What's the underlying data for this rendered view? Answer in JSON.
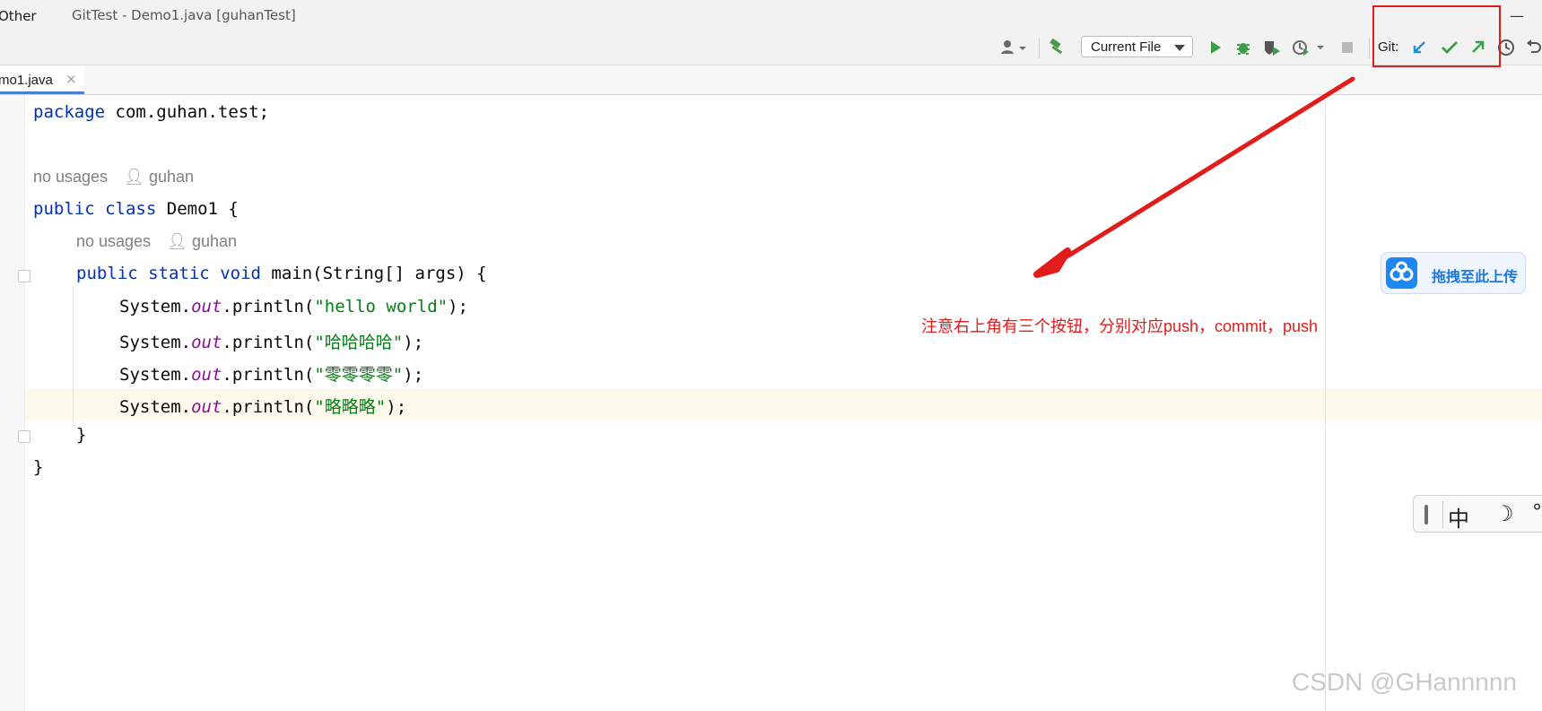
{
  "window": {
    "menu_other": "Other",
    "title": "GitTest - Demo1.java [guhanTest]",
    "minimize_glyph": "—"
  },
  "toolbar": {
    "run_config": "Current File",
    "git_label": "Git:"
  },
  "tab": {
    "label": "mo1.java",
    "close_glyph": "×"
  },
  "editor": {
    "package_kw": "package",
    "package_name": " com.guhan.test;",
    "usage_hint_1": "no usages",
    "author_1": "guhan",
    "class_kw_public": "public",
    "class_kw_class": "class",
    "class_name": "Demo1",
    "class_brace": " {",
    "usage_hint_2": "no usages",
    "author_2": "guhan",
    "method_kw_public": "public",
    "method_kw_static": "static",
    "method_kw_void": "void",
    "method_sig": " main(String[] args) {",
    "println_lines": [
      {
        "pre": "System.",
        "out": "out",
        "mid": ".println(",
        "str": "\"hello world\"",
        "end": ");"
      },
      {
        "pre": "System.",
        "out": "out",
        "mid": ".println(",
        "str": "\"哈哈哈哈\"",
        "end": ");"
      },
      {
        "pre": "System.",
        "out": "out",
        "mid": ".println(",
        "str": "\"零零零零\"",
        "end": ");"
      },
      {
        "pre": "System.",
        "out": "out",
        "mid": ".println(",
        "str": "\"略略略\"",
        "end": ");"
      }
    ],
    "method_close": "}",
    "class_close": "}"
  },
  "annotation": {
    "text": "注意右上角有三个按钮，分别对应push，commit，push",
    "color": "#e21b1b"
  },
  "overlay_upload": {
    "label": "拖拽至此上传"
  },
  "ime": {
    "chinese": "中",
    "moon": "☽",
    "degree": "°"
  },
  "watermark": "CSDN @GHannnnn",
  "colors": {
    "keyword": "#0033b3",
    "string": "#067d17",
    "static_field": "#871094",
    "git_update": "#1f8fd6",
    "git_commit": "#3a9f46",
    "git_push": "#3a9f46"
  },
  "icons": [
    "user-icon",
    "build-hammer-icon",
    "run-icon",
    "debug-icon",
    "coverage-icon",
    "profile-icon",
    "stop-icon",
    "git-update-icon",
    "git-commit-icon",
    "git-push-icon",
    "history-icon",
    "rollback-icon"
  ]
}
